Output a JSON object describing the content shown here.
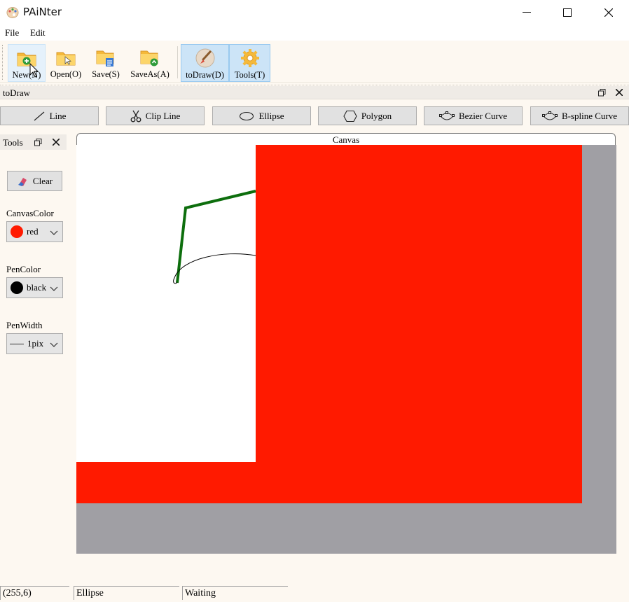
{
  "window": {
    "title": "PAiNter"
  },
  "menu": {
    "items": [
      "File",
      "Edit"
    ]
  },
  "toolbar": {
    "buttons": [
      {
        "label": "New(N)",
        "icon": "folder-new-icon"
      },
      {
        "label": "Open(O)",
        "icon": "folder-open-icon"
      },
      {
        "label": "Save(S)",
        "icon": "folder-save-icon"
      },
      {
        "label": "SaveAs(A)",
        "icon": "folder-saveas-icon"
      },
      {
        "label": "toDraw(D)",
        "icon": "brush-icon"
      },
      {
        "label": "Tools(T)",
        "icon": "gear-icon"
      }
    ]
  },
  "dock": {
    "title": "toDraw"
  },
  "shapes": {
    "buttons": [
      "Line",
      "Clip Line",
      "Ellipse",
      "Polygon",
      "Bezier Curve",
      "B-spline Curve"
    ]
  },
  "tools_panel": {
    "title": "Tools",
    "clear_label": "Clear",
    "canvas_color_label": "CanvasColor",
    "canvas_color_value": "red",
    "pen_color_label": "PenColor",
    "pen_color_value": "black",
    "pen_width_label": "PenWidth",
    "pen_width_value": "1pix"
  },
  "canvas": {
    "tab_label": "Canvas",
    "fill_color": "#ff1a00",
    "line_color": "#0d6e0d"
  },
  "status": {
    "coords": "(255,6)",
    "tool": "Ellipse",
    "state": "Waiting"
  }
}
